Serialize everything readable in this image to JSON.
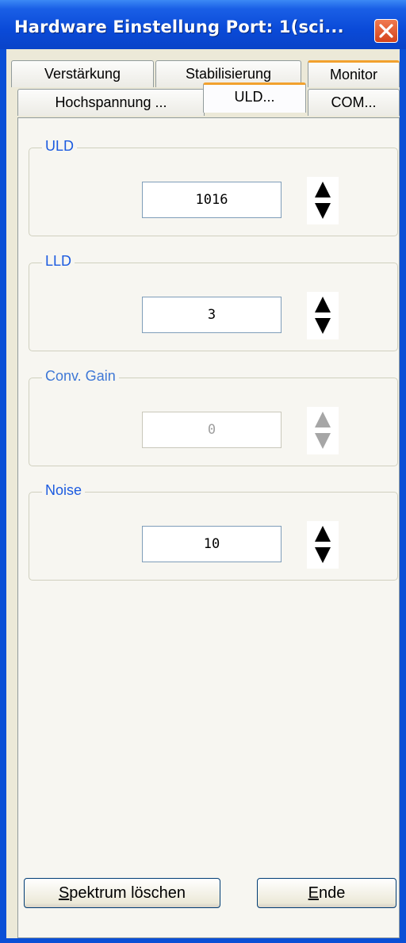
{
  "window": {
    "title": "Hardware Einstellung Port: 1(sci...",
    "close_label": "close"
  },
  "tabs": {
    "row1": [
      "Verstärkung",
      "Stabilisierung",
      "Monitor"
    ],
    "row2": [
      "Hochspannung ...",
      "ULD...",
      "COM..."
    ],
    "active": "ULD...",
    "hot": "Monitor"
  },
  "groups": [
    {
      "label": "ULD",
      "value": "1016",
      "enabled": true
    },
    {
      "label": "LLD",
      "value": "3",
      "enabled": true
    },
    {
      "label": "Conv. Gain",
      "value": "0",
      "enabled": false
    },
    {
      "label": "Noise",
      "value": "10",
      "enabled": true
    }
  ],
  "buttons": {
    "clear_spectrum": "Spektrum löschen",
    "clear_spectrum_mnemonic": "S",
    "end": "Ende",
    "end_mnemonic": "E"
  },
  "colors": {
    "title_bar": "#0a4fd6",
    "group_label": "#1c5be0",
    "tab_highlight": "#f2a12e",
    "face": "#ece9d8"
  }
}
